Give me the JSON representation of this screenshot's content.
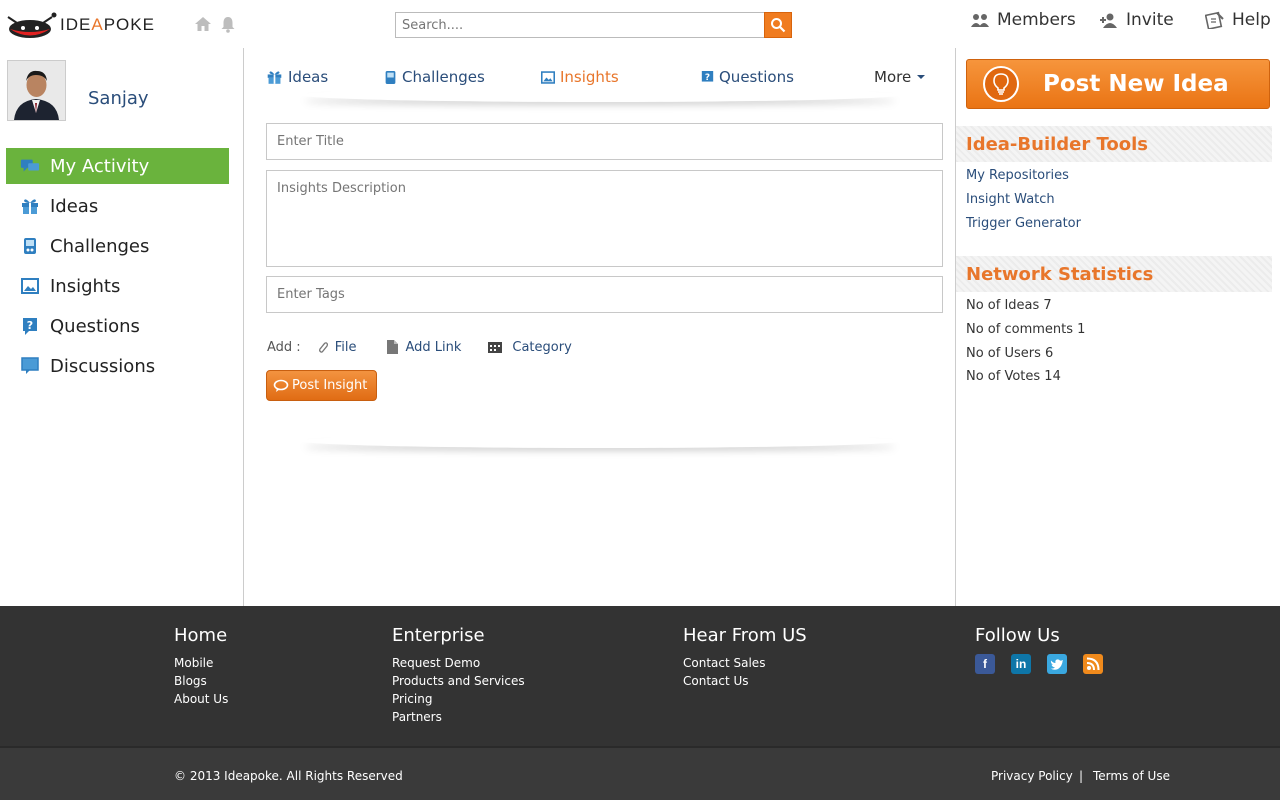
{
  "header": {
    "logo_text_1": "IDE",
    "logo_text_2": "A",
    "logo_text_3": "POKE",
    "search_placeholder": "Search....",
    "nav": [
      {
        "label": "Members",
        "icon": "members-icon"
      },
      {
        "label": "Invite",
        "icon": "invite-icon"
      },
      {
        "label": "Help",
        "icon": "help-icon"
      }
    ]
  },
  "sidebar": {
    "username": "Sanjay",
    "items": [
      {
        "label": "My Activity",
        "icon": "activity-icon",
        "active": true
      },
      {
        "label": "Ideas",
        "icon": "gift-icon"
      },
      {
        "label": "Challenges",
        "icon": "gamepad-icon"
      },
      {
        "label": "Insights",
        "icon": "image-icon"
      },
      {
        "label": "Questions",
        "icon": "question-icon"
      },
      {
        "label": "Discussions",
        "icon": "monitor-icon"
      }
    ]
  },
  "tabs": [
    {
      "label": "Ideas"
    },
    {
      "label": "Challenges"
    },
    {
      "label": "Insights",
      "active": true
    },
    {
      "label": "Questions"
    },
    {
      "label": "More"
    }
  ],
  "form": {
    "title_placeholder": "Enter Title",
    "description_placeholder": "Insights Description",
    "tags_placeholder": "Enter Tags",
    "add_label": "Add :",
    "add_file": "File",
    "add_link": "Add Link",
    "add_category": "Category",
    "post_button": "Post Insight"
  },
  "right": {
    "post_idea": "Post New Idea",
    "tools_title": "Idea-Builder Tools",
    "tools": [
      "My Repositories",
      "Insight Watch",
      "Trigger Generator"
    ],
    "stats_title": "Network Statistics",
    "stats": [
      "No of Ideas 7",
      "No of comments 1",
      "No of Users 6",
      "No of Votes 14"
    ]
  },
  "footer": {
    "columns": [
      {
        "title": "Home",
        "links": [
          "Mobile",
          "Blogs",
          "About Us"
        ]
      },
      {
        "title": "Enterprise",
        "links": [
          "Request Demo",
          "Products and Services",
          "Pricing",
          "Partners"
        ]
      },
      {
        "title": "Hear From US",
        "links": [
          "Contact Sales",
          "Contact Us"
        ]
      },
      {
        "title": "Follow Us",
        "links": []
      }
    ],
    "social": [
      {
        "name": "facebook-icon",
        "glyph": "f",
        "color": "#3b5998"
      },
      {
        "name": "linkedin-icon",
        "glyph": "in",
        "color": "#0e76a8"
      },
      {
        "name": "twitter-icon",
        "glyph": "t",
        "color": "#3aa8e0"
      },
      {
        "name": "rss-icon",
        "glyph": ")",
        "color": "#f08a1c"
      }
    ],
    "copyright": "© 2013 Ideapoke. All Rights Reserved",
    "privacy": "Privacy Policy",
    "separator": "|",
    "terms": "Terms of Use"
  },
  "colors": {
    "accent": "#e8762b",
    "active_green": "#6ab33d",
    "link_blue": "#2a4d7a",
    "footer_bg": "#333333"
  }
}
